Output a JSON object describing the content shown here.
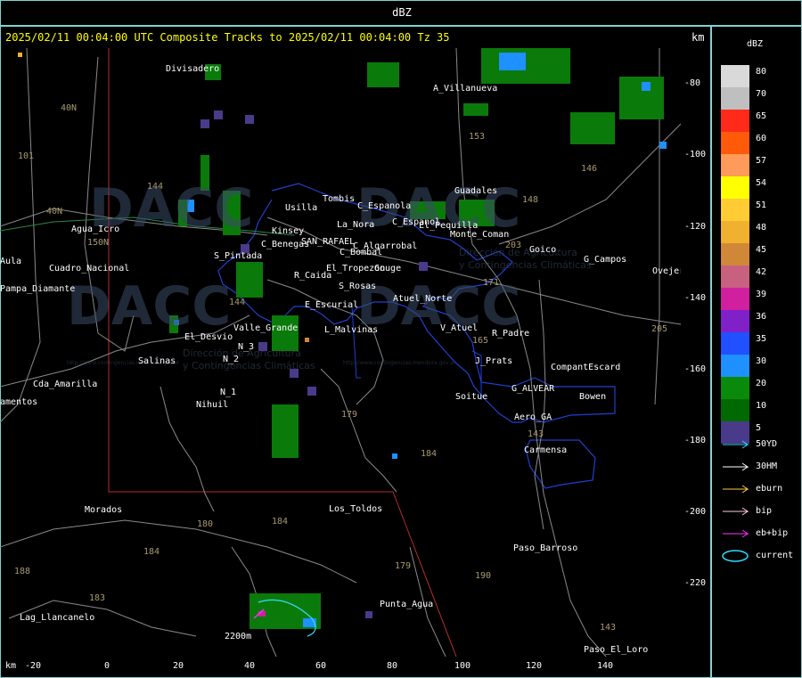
{
  "window": {
    "title": "dBZ"
  },
  "header": {
    "line": "2025/02/11 00:04:00 UTC Composite Tracks to 2025/02/11 00:04:00 Tz 35",
    "unit": "km"
  },
  "axes": {
    "bottom_unit": "km",
    "x_ticks": [
      "-20",
      "0",
      "20",
      "40",
      "60",
      "80",
      "100",
      "120",
      "140"
    ],
    "y_ticks": [
      "-80",
      "-100",
      "-120",
      "-140",
      "-160",
      "-180",
      "-200",
      "-220"
    ]
  },
  "legend": {
    "title": "dBZ",
    "levels": [
      {
        "label": "80",
        "color": "#d9d9d9"
      },
      {
        "label": "70",
        "color": "#bfbfbf"
      },
      {
        "label": "65",
        "color": "#ff2a1a"
      },
      {
        "label": "60",
        "color": "#ff5a0a"
      },
      {
        "label": "57",
        "color": "#ff9a5a"
      },
      {
        "label": "54",
        "color": "#ffff00"
      },
      {
        "label": "51",
        "color": "#ffcc33"
      },
      {
        "label": "48",
        "color": "#f0b030"
      },
      {
        "label": "45",
        "color": "#d08838"
      },
      {
        "label": "42",
        "color": "#c86080"
      },
      {
        "label": "39",
        "color": "#d020a0"
      },
      {
        "label": "36",
        "color": "#8020c8"
      },
      {
        "label": "35",
        "color": "#2050ff"
      },
      {
        "label": "30",
        "color": "#1e90ff"
      },
      {
        "label": "20",
        "color": "#0a8a0a"
      },
      {
        "label": "10",
        "color": "#006a00"
      },
      {
        "label": "5",
        "color": "#4a3a8a"
      }
    ],
    "tracks": [
      {
        "label": "50YD",
        "color": "#33ddff"
      },
      {
        "label": "30HM",
        "color": "#ffffff"
      },
      {
        "label": "eburn",
        "color": "#ffcc44"
      },
      {
        "label": "bip",
        "color": "#ffccdd"
      },
      {
        "label": "eb+bip",
        "color": "#ff33ff"
      },
      {
        "label": "current",
        "color": "#33ddff"
      }
    ]
  },
  "places": [
    "Divisadero",
    "A_Villanueva",
    "Tombis",
    "Usilla",
    "C_Espanola",
    "La_Nora",
    "El_Pequilla",
    "C_Espanol",
    "Guadales",
    "C_Benegas",
    "SAN_RAFAEL",
    "C_Algarrobal",
    "C_Bombal",
    "Goico",
    "G_Campos",
    "Ovejeros",
    "Agua_Icro",
    "Cuadro_Nacional",
    "Aula",
    "Pampa_Diamante",
    "S_Pintada",
    "R_Caida",
    "El_Tropezon",
    "Gouge",
    "S_Rosas",
    "Atuel_Norte",
    "E_Escurial",
    "El_Desvio",
    "Valle_Grande",
    "L_Malvinas",
    "V_Atuel",
    "R_Padre",
    "N_3",
    "N_2",
    "Salinas",
    "J_Prats",
    "CompantEscard",
    "Cda_Amarilla",
    "amentos",
    "N_1",
    "Nihuil",
    "Soitue",
    "G_ALVEAR",
    "Bowen",
    "Aero_GA",
    "Carmensa",
    "Morados",
    "Los_Toldos",
    "Paso_Barroso",
    "Lag_Llancanelo",
    "Punta_Agua",
    "2200m",
    "Paso_El_Loro",
    "Monte_Coman",
    "Kinsey"
  ],
  "routes": [
    "101",
    "40N",
    "40N",
    "150N",
    "144",
    "144",
    "153",
    "146",
    "148",
    "203",
    "171",
    "165",
    "179",
    "184",
    "184",
    "180",
    "184",
    "183",
    "179",
    "190",
    "143",
    "143",
    "205",
    "188"
  ],
  "watermark": {
    "name": "DACC",
    "subtitle_1": "Dirección de Agricultura",
    "subtitle_2": "y Contingencias Climáticas",
    "url": "http://www.contingencias.mendoza.gov.ar"
  }
}
